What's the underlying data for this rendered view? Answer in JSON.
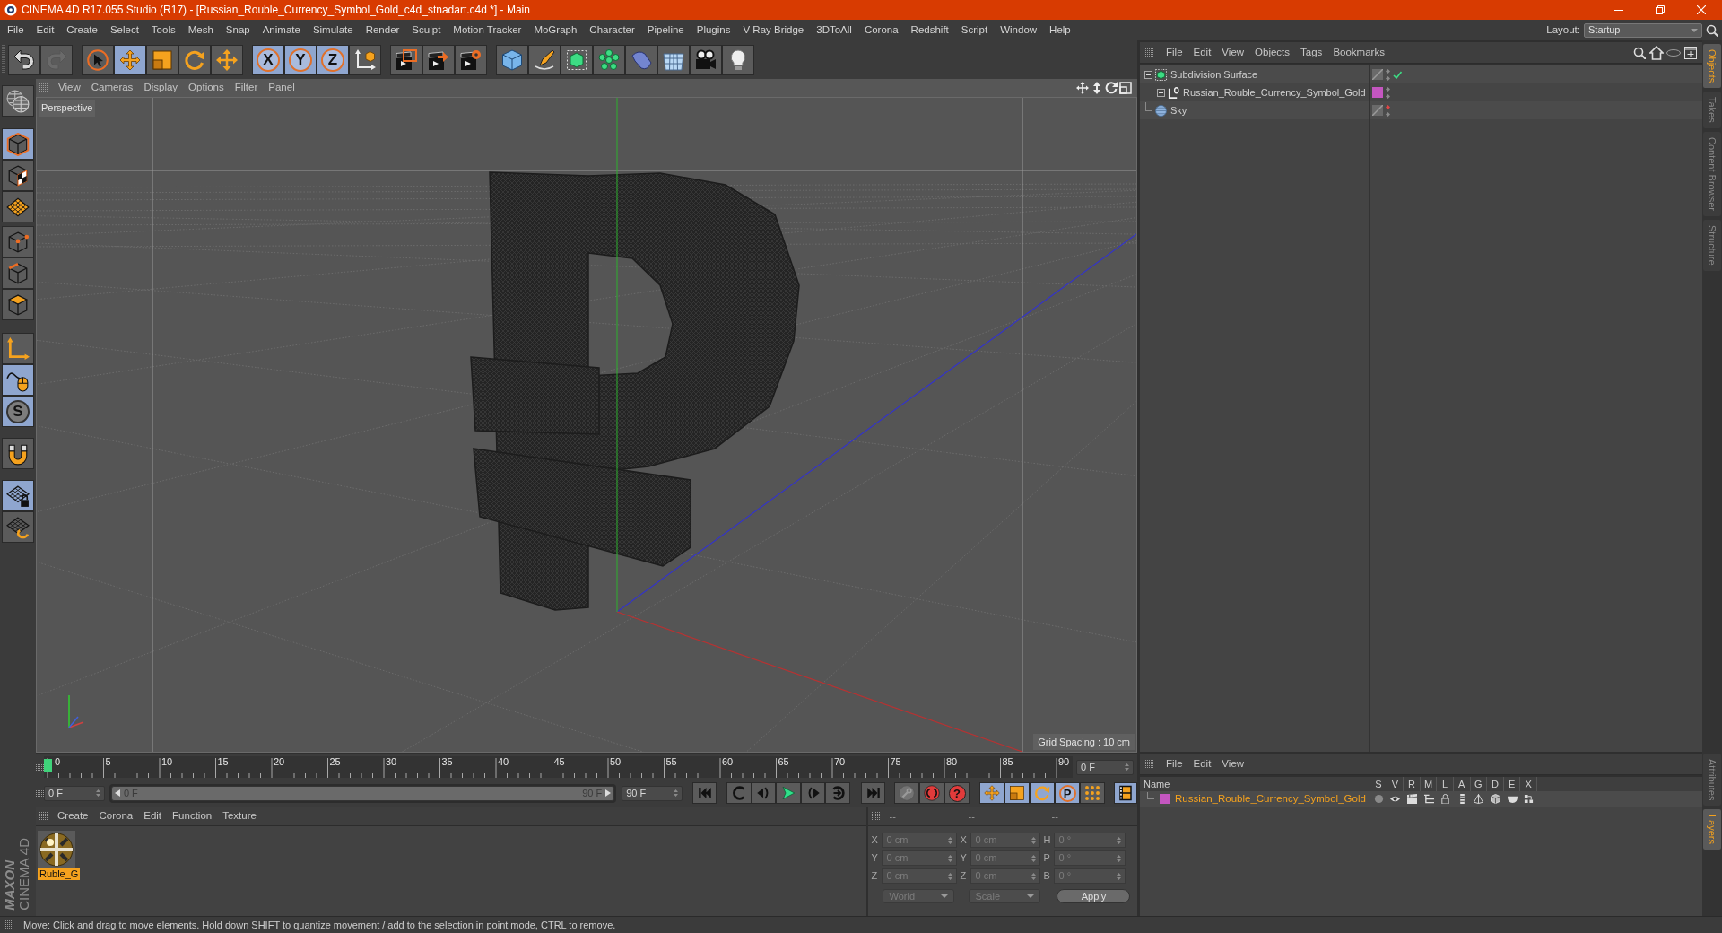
{
  "window": {
    "title": "CINEMA 4D R17.055 Studio (R17) - [Russian_Rouble_Currency_Symbol_Gold_c4d_stnadart.c4d *] - Main"
  },
  "menu_bar": {
    "items": [
      "File",
      "Edit",
      "Create",
      "Select",
      "Tools",
      "Mesh",
      "Snap",
      "Animate",
      "Simulate",
      "Render",
      "Sculpt",
      "Motion Tracker",
      "MoGraph",
      "Character",
      "Pipeline",
      "Plugins",
      "V-Ray Bridge",
      "3DToAll",
      "Corona",
      "Redshift",
      "Script",
      "Window",
      "Help"
    ],
    "layout_label": "Layout:",
    "layout_value": "Startup"
  },
  "toolbar": {
    "groups": [
      {
        "tools": [
          {
            "selected": false,
            "disabled": false
          },
          {
            "selected": false,
            "disabled": true
          }
        ]
      },
      {
        "tools": [
          {
            "selected": false
          },
          {
            "selected": true
          },
          {
            "selected": false
          },
          {
            "selected": false
          },
          {
            "selected": false
          }
        ]
      },
      {
        "tools": [
          {
            "label": "X",
            "selected": true
          },
          {
            "label": "Y",
            "selected": true
          },
          {
            "label": "Z",
            "selected": true
          },
          {
            "selected": false
          }
        ]
      },
      {
        "tools": [
          {
            "selected": false
          },
          {
            "selected": false
          },
          {
            "selected": false
          }
        ]
      },
      {
        "tools": [
          {
            "selected": false
          },
          {
            "selected": false
          },
          {
            "selected": false
          },
          {
            "selected": false
          },
          {
            "selected": false
          },
          {
            "selected": false
          },
          {
            "selected": false
          },
          {
            "selected": false
          }
        ]
      }
    ]
  },
  "left_toolbar": {
    "groups": [
      {
        "tools": [
          {
            "selected": false
          }
        ]
      },
      {
        "tools": [
          {
            "selected": true
          },
          {
            "selected": false
          },
          {
            "selected": false
          }
        ]
      },
      {
        "tools": [
          {
            "selected": false
          },
          {
            "selected": false
          },
          {
            "selected": false
          }
        ]
      },
      {
        "tools": [
          {
            "selected": false
          },
          {
            "selected": true
          },
          {
            "label": "S",
            "selected": true
          }
        ]
      },
      {
        "tools": [
          {
            "selected": false
          }
        ]
      },
      {
        "tools": [
          {
            "selected": true
          },
          {
            "selected": false
          }
        ]
      }
    ]
  },
  "viewport": {
    "menu": [
      "View",
      "Cameras",
      "Display",
      "Options",
      "Filter",
      "Panel"
    ],
    "camera": "Perspective",
    "grid_spacing": "Grid Spacing : 10 cm"
  },
  "timeline": {
    "ticks": [
      "0",
      "5",
      "10",
      "15",
      "20",
      "25",
      "30",
      "35",
      "40",
      "45",
      "50",
      "55",
      "60",
      "65",
      "70",
      "75",
      "80",
      "85",
      "90"
    ],
    "playhead": {
      "level": 0
    },
    "current_frame": "0 F",
    "start_frame": "0 F",
    "range": {
      "start": "0 F",
      "end": "90 F",
      "level": 1
    },
    "end_frame": "90 F"
  },
  "transport": {
    "record_label": "?",
    "key_modes": [
      {
        "selected": true
      },
      {
        "selected": true
      },
      {
        "selected": true
      },
      {
        "label": "P",
        "selected": true
      },
      {
        "selected": false
      }
    ],
    "timeline_button": {
      "selected": true
    }
  },
  "materials": {
    "menu": [
      "Create",
      "Corona",
      "Edit",
      "Function",
      "Texture"
    ],
    "items": [
      {
        "name": "Ruble_G",
        "selected": true
      }
    ]
  },
  "coordinates": {
    "headers": [
      "--",
      "--",
      "--"
    ],
    "rows": [
      {
        "cells": [
          {
            "label": "X",
            "value": "0 cm"
          },
          {
            "label": "X",
            "value": "0 cm"
          },
          {
            "label": "H",
            "value": "0 °"
          }
        ]
      },
      {
        "cells": [
          {
            "label": "Y",
            "value": "0 cm"
          },
          {
            "label": "Y",
            "value": "0 cm"
          },
          {
            "label": "P",
            "value": "0 °"
          }
        ]
      },
      {
        "cells": [
          {
            "label": "Z",
            "value": "0 cm"
          },
          {
            "label": "Z",
            "value": "0 cm"
          },
          {
            "label": "B",
            "value": "0 °"
          }
        ]
      }
    ],
    "dropdowns": [
      "World",
      "Scale"
    ],
    "apply": "Apply"
  },
  "object_manager": {
    "menu": [
      "File",
      "Edit",
      "View",
      "Objects",
      "Tags",
      "Bookmarks"
    ],
    "objects": [
      {
        "name": "Subdivision Surface",
        "kind": "generator",
        "expanded": true,
        "enabled": true,
        "editor_hidden": false,
        "children": [
          {
            "name": "Russian_Rouble_Currency_Symbol_Gold",
            "kind": "null",
            "expanded": false,
            "color": "#c456c0",
            "editor_hidden": false
          }
        ]
      },
      {
        "name": "Sky",
        "kind": "sky",
        "editor_hidden": true
      }
    ]
  },
  "layer_manager": {
    "menu": [
      "File",
      "Edit",
      "View"
    ],
    "columns": [
      "Name",
      "S",
      "V",
      "R",
      "M",
      "L",
      "A",
      "G",
      "D",
      "E",
      "X"
    ],
    "layers": [
      {
        "name": "Russian_Rouble_Currency_Symbol_Gold",
        "color": "#c456c0",
        "selected": true
      }
    ]
  },
  "side_tabs": {
    "top": [
      {
        "label": "Objects",
        "selected": true
      },
      {
        "label": "Takes",
        "selected": false
      },
      {
        "label": "Content Browser",
        "selected": false
      },
      {
        "label": "Structure",
        "selected": false
      }
    ],
    "bottom": [
      {
        "label": "Attributes",
        "selected": false
      },
      {
        "label": "Layers",
        "selected": true
      }
    ]
  },
  "branding": {
    "brand": "MAXON",
    "product": "CINEMA 4D"
  },
  "status_bar": {
    "text": "Move: Click and drag to move elements. Hold down SHIFT to quantize movement / add to the selection in point mode, CTRL to remove."
  }
}
